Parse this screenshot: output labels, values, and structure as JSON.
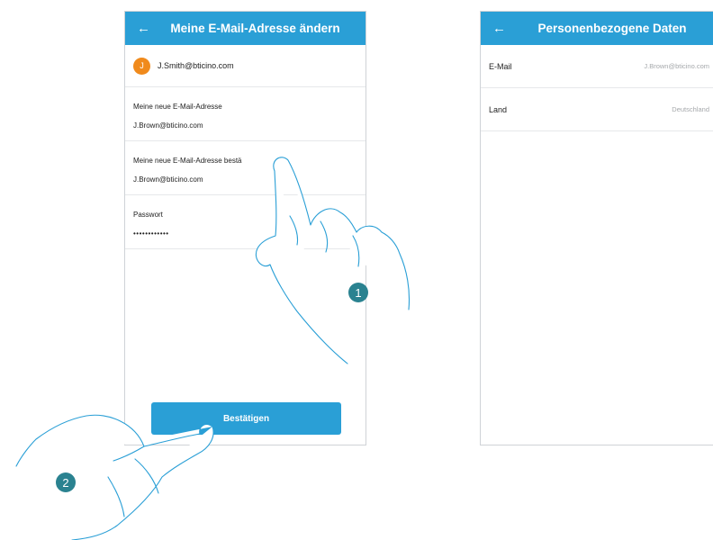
{
  "screen1": {
    "header": {
      "title": "Meine E-Mail-Adresse ändern",
      "back_icon": "←"
    },
    "account": {
      "avatar_initial": "J",
      "email": "J.Smith@bticino.com"
    },
    "fields": [
      {
        "label": "Meine neue E-Mail-Adresse",
        "value": "J.Brown@bticino.com"
      },
      {
        "label": "Meine neue E-Mail-Adresse bestä",
        "value": "J.Brown@bticino.com"
      },
      {
        "label": "Passwort",
        "value": "••••••••••••"
      }
    ],
    "confirm_label": "Bestätigen"
  },
  "screen2": {
    "header": {
      "title": "Personenbezogene Daten",
      "back_icon": "←"
    },
    "rows": [
      {
        "label": "E-Mail",
        "value": "J.Brown@bticino.com"
      },
      {
        "label": "Land",
        "value": "Deutschland"
      }
    ]
  },
  "callouts": {
    "step1": "1",
    "step2": "2"
  },
  "colors": {
    "accent": "#2a9fd6",
    "avatar": "#f08a1c",
    "badge": "#2a8290"
  }
}
